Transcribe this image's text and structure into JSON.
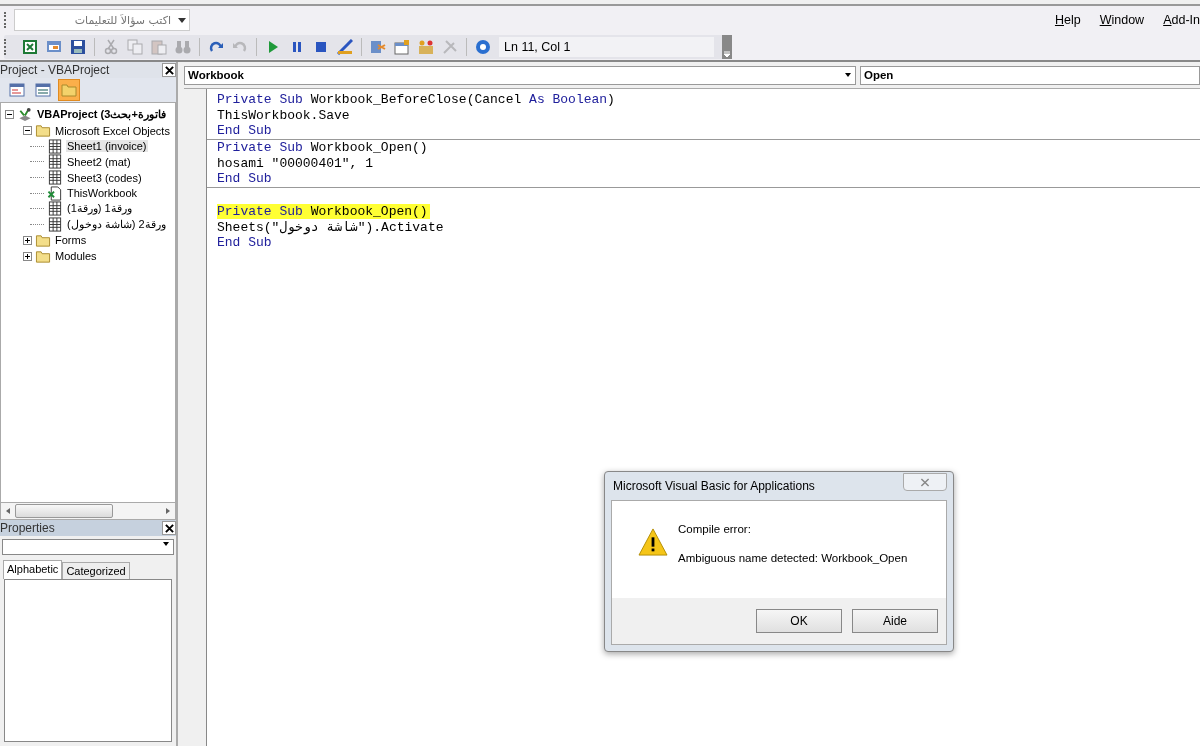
{
  "question_box": {
    "placeholder": "اكتب سؤالاً للتعليمات"
  },
  "menus": [
    {
      "label": "Help"
    },
    {
      "label": "Window"
    },
    {
      "label": "Add-In"
    }
  ],
  "toolbar": [
    {
      "kind": "excel",
      "disabled": false
    },
    {
      "kind": "form",
      "disabled": false
    },
    {
      "kind": "save",
      "disabled": false
    },
    {
      "kind": "cut",
      "disabled": true
    },
    {
      "kind": "copy",
      "disabled": true
    },
    {
      "kind": "paste",
      "disabled": true
    },
    {
      "kind": "find",
      "disabled": true
    },
    {
      "kind": "redo",
      "disabled": false
    },
    {
      "kind": "undo",
      "disabled": true
    },
    {
      "kind": "run",
      "disabled": false
    },
    {
      "kind": "pause",
      "disabled": false
    },
    {
      "kind": "stop",
      "disabled": false
    },
    {
      "kind": "design",
      "disabled": false
    },
    {
      "kind": "explorer",
      "disabled": false
    },
    {
      "kind": "properties",
      "disabled": false
    },
    {
      "kind": "browser",
      "disabled": false
    },
    {
      "kind": "toolbox",
      "disabled": true
    },
    {
      "kind": "help",
      "disabled": false
    }
  ],
  "cursor_position": "Ln 11, Col 1",
  "project_panel": {
    "title": "Project - VBAProject",
    "buttons": [
      {
        "kind": "code",
        "selected": false
      },
      {
        "kind": "object",
        "selected": false
      },
      {
        "kind": "folder",
        "selected": true
      }
    ],
    "tree": [
      {
        "label": "VBAProject (فاتورة+بحث3",
        "kind": "project",
        "expanded": true,
        "selected": false,
        "children": [
          {
            "label": "Microsoft Excel Objects",
            "kind": "folder",
            "expanded": true,
            "selected": false,
            "children": [
              {
                "label": "Sheet1 (invoice)",
                "kind": "sheet",
                "selected": true
              },
              {
                "label": "Sheet2 (mat)",
                "kind": "sheet",
                "selected": false
              },
              {
                "label": "Sheet3 (codes)",
                "kind": "sheet",
                "selected": false
              },
              {
                "label": "ThisWorkbook",
                "kind": "workbook",
                "selected": false
              },
              {
                "label": "ورقة1 (ورقة1)",
                "kind": "sheet",
                "selected": false
              },
              {
                "label": "ورقة2 (شاشة دوخول)",
                "kind": "sheet",
                "selected": false
              }
            ]
          },
          {
            "label": "Forms",
            "kind": "folder",
            "expanded": false,
            "selected": false
          },
          {
            "label": "Modules",
            "kind": "folder",
            "expanded": false,
            "selected": false
          }
        ]
      }
    ]
  },
  "properties_panel": {
    "title": "Properties",
    "tabs": [
      {
        "label": "Alphabetic",
        "selected": true
      },
      {
        "label": "Categorized",
        "selected": false
      }
    ]
  },
  "code_window": {
    "object": "Workbook",
    "procedure": "Open",
    "procedures": [
      {
        "lines": [
          {
            "highlighted": false,
            "segments": [
              {
                "kind": "keyword",
                "text": "Private Sub"
              },
              {
                "kind": "plain",
                "text": " Workbook_BeforeClose(Cancel "
              },
              {
                "kind": "keyword",
                "text": "As Boolean"
              },
              {
                "kind": "plain",
                "text": ")"
              }
            ]
          },
          {
            "highlighted": false,
            "segments": [
              {
                "kind": "plain",
                "text": "ThisWorkbook.Save"
              }
            ]
          },
          {
            "highlighted": false,
            "segments": [
              {
                "kind": "keyword",
                "text": "End Sub"
              }
            ]
          }
        ]
      },
      {
        "lines": [
          {
            "highlighted": false,
            "segments": [
              {
                "kind": "keyword",
                "text": "Private Sub"
              },
              {
                "kind": "plain",
                "text": " Workbook_Open()"
              }
            ]
          },
          {
            "highlighted": false,
            "segments": [
              {
                "kind": "plain",
                "text": "hosami \"00000401\", 1"
              }
            ]
          },
          {
            "highlighted": false,
            "segments": [
              {
                "kind": "keyword",
                "text": "End Sub"
              }
            ]
          }
        ]
      },
      {
        "lines": [
          {
            "highlighted": true,
            "segments": [
              {
                "kind": "keyword",
                "text": "Private Sub"
              },
              {
                "kind": "plain",
                "text": " Workbook_Open()"
              }
            ]
          },
          {
            "highlighted": false,
            "segments": [
              {
                "kind": "plain",
                "text": "Sheets(\"شاشة دوخول\").Activate"
              }
            ]
          },
          {
            "highlighted": false,
            "segments": [
              {
                "kind": "keyword",
                "text": "End Sub"
              }
            ]
          }
        ]
      }
    ]
  },
  "dialog": {
    "title": "Microsoft Visual Basic for Applications",
    "heading": "Compile error:",
    "message": "Ambiguous name detected: Workbook_Open",
    "buttons": [
      {
        "label": "OK"
      },
      {
        "label": "Aide"
      }
    ]
  }
}
